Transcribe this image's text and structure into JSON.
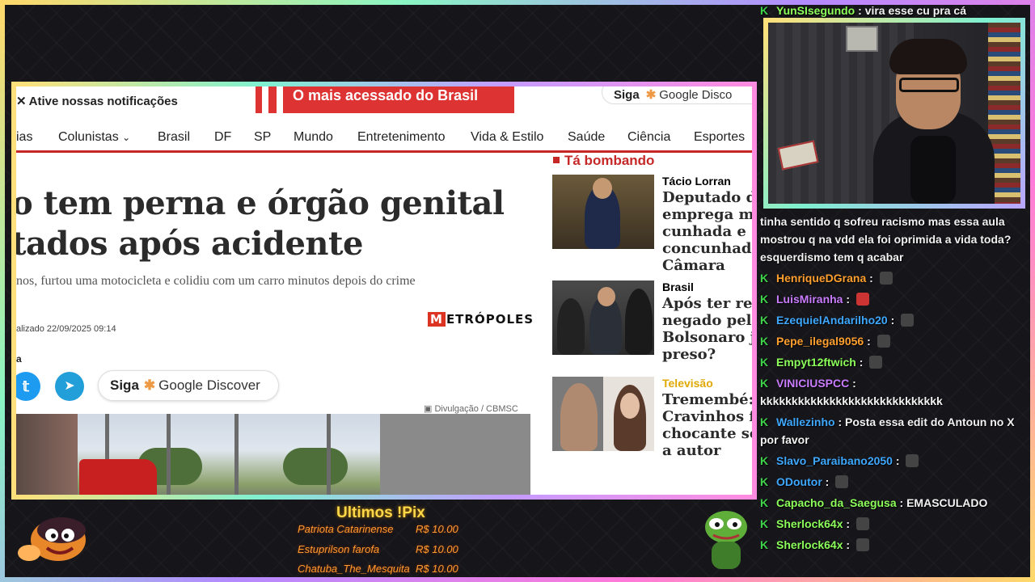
{
  "browser": {
    "notification_text": "Ative nossas notificações",
    "promo_text": "O mais acessado do Brasil",
    "siga_top_label": "Siga",
    "siga_top_service": "Google Disco",
    "nav_items": [
      "ias",
      "Colunistas",
      "Brasil",
      "DF",
      "SP",
      "Mundo",
      "Entretenimento",
      "Vida & Estilo",
      "Saúde",
      "Ciência",
      "Esportes"
    ],
    "headline_line1": "o tem perna e órgão genital",
    "headline_line2": "tados após acidente",
    "subheadline": "nos, furtou uma motocicleta e colidiu com um carro minutos depois do crime",
    "updated_label": "alizado",
    "updated_time": "22/09/2025 09:14",
    "logo_text": "ETRÓPOLES",
    "logo_initial": "M",
    "share_label": "a",
    "siga_button_label": "Siga",
    "siga_button_service": "Google Discover",
    "photo_credit": "Divulgação / CBMSC",
    "sidebar": {
      "heading": "Tá bombando",
      "stories": [
        {
          "tag": "Tácio Lorran",
          "tag_color": "#b71c1c",
          "title": "Deputado do emprega mu cunhada e concunhado Câmara"
        },
        {
          "tag": "Brasil",
          "tag_color": "#b71c1c",
          "title": "Após ter recu negado pelo Bolsonaro já preso?"
        },
        {
          "tag": "Televisão",
          "tag_color": "#e0a800",
          "title": "Tremembé: Cravinhos fe chocante sol a autor"
        }
      ]
    }
  },
  "chat": {
    "top_user": "YunSIsegundo",
    "top_message": "vira esse cu pra cá",
    "continued_lines": [
      "tinha sentido q sofreu racismo mas essa aula",
      "mostrou q na vdd ela foi oprimida a vida toda?",
      "esquerdismo tem q acabar"
    ],
    "messages": [
      {
        "user": "HenriqueDGrana",
        "color": "#ff9f2e",
        "text": ""
      },
      {
        "user": "LuisMiranha",
        "color": "#c97cff",
        "text": ""
      },
      {
        "user": "EzequielAndarilho20",
        "color": "#3ea8ff",
        "text": ""
      },
      {
        "user": "Pepe_ilegal9056",
        "color": "#ff9f2e",
        "text": ""
      },
      {
        "user": "Empyt12ftwich",
        "color": "#8cff5a",
        "text": ""
      },
      {
        "user": "VINICIUSPCC",
        "color": "#c97cff",
        "text": ""
      },
      {
        "user": "Wallezinho",
        "color": "#3ea8ff",
        "text": "Posta essa edit do Antoun no X"
      },
      {
        "user": "Slavo_Paraibano2050",
        "color": "#3ea8ff",
        "text": ""
      },
      {
        "user": "ODoutor",
        "color": "#3ea8ff",
        "text": ""
      },
      {
        "user": "Capacho_da_Saegusa",
        "color": "#8cff5a",
        "text": "EMASCULADO"
      },
      {
        "user": "Sherlock64x",
        "color": "#8cff5a",
        "text": ""
      },
      {
        "user": "Sherlock64x",
        "color": "#8cff5a",
        "text": ""
      }
    ],
    "vinicius_continued": "kkkkkkkkkkkkkkkkkkkkkkkkkkkkk",
    "wallezinho_continued": "por favor"
  },
  "pix": {
    "title": "Ultimos !Pix",
    "rows": [
      {
        "name": "Patriota Catarinense",
        "amount": "R$ 10.00"
      },
      {
        "name": "Estuprilson farofa",
        "amount": "R$ 10.00"
      },
      {
        "name": "Chatuba_The_Mesquita",
        "amount": "R$ 10.00"
      }
    ]
  }
}
